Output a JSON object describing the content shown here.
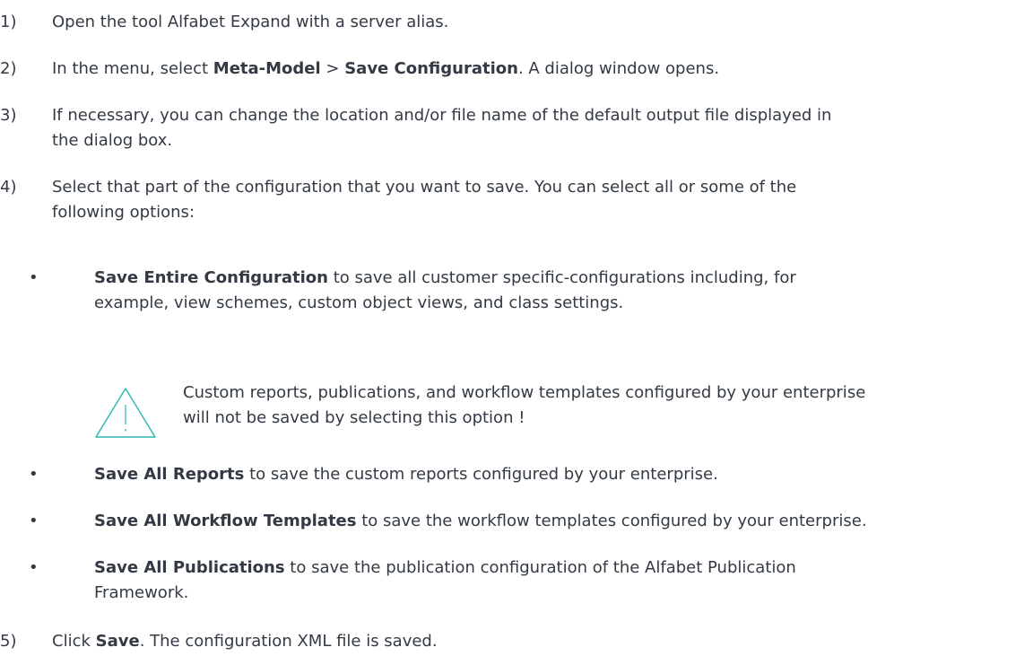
{
  "steps": [
    {
      "num": "1)",
      "text": "Open the tool Alfabet Expand with a server alias."
    },
    {
      "num": "2)",
      "pre": "In the menu, select ",
      "b1": "Meta-Model",
      "mid": " > ",
      "b2": "Save Configuration",
      "post": ". A dialog window opens."
    },
    {
      "num": "3)",
      "line1": "If necessary, you can change the location and/or file name of the default output file displayed in",
      "line2": "the dialog box."
    },
    {
      "num": "4)",
      "line1": "Select that part of the configuration that you want to save. You can select all or some of the",
      "line2": "following options:"
    },
    {
      "num": "5)",
      "pre": "Click ",
      "bold": "Save",
      "post": ". The configuration XML file is saved."
    }
  ],
  "options": [
    {
      "bullet": "•",
      "bold": "Save Entire Configuration",
      "line1": " to save all customer specific-configurations including, for",
      "line2": "example, view schemes, custom object views, and class settings."
    },
    {
      "bullet": "•",
      "bold": "Save All Reports",
      "rest": " to save the custom reports configured by your enterprise."
    },
    {
      "bullet": "•",
      "bold": "Save All Workflow Templates",
      "rest": " to save the workflow templates configured by your enterprise."
    },
    {
      "bullet": "•",
      "bold": "Save All Publications",
      "line1": " to save the publication configuration of the Alfabet Publication",
      "line2": "Framework."
    }
  ],
  "note": {
    "icon": "warning-triangle-icon",
    "line1": "Custom reports, publications, and workflow templates configured by your enterprise",
    "line2": "will not be saved by selecting this option !",
    "icon_color": "#2bb7b0"
  }
}
